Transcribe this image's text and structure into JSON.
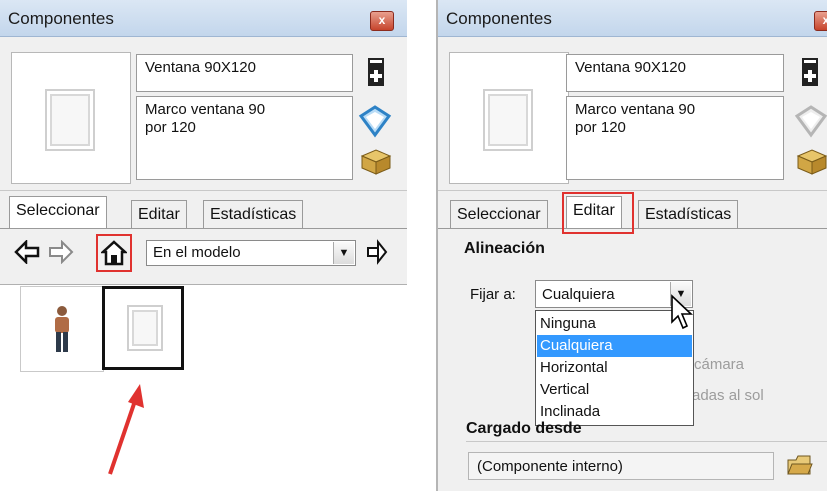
{
  "left_panel": {
    "title": "Componentes",
    "close_label": "x",
    "component_name": "Ventana 90X120",
    "component_description": "Marco ventana 90\npor 120",
    "tabs": [
      "Seleccionar",
      "Editar",
      "Estadísticas"
    ],
    "active_tab": "Seleccionar",
    "nav_icons": [
      "back-arrow-icon",
      "forward-arrow-icon",
      "home-icon"
    ],
    "location_select": "En el modelo",
    "details_icon": "details-arrow-icon",
    "component_items": [
      "person-icon",
      "window-icon"
    ]
  },
  "right_panel": {
    "title": "Componentes",
    "close_label": "x",
    "component_name": "Ventana 90X120",
    "component_description": "Marco ventana 90\npor 120",
    "tabs": [
      "Seleccionar",
      "Editar",
      "Estadísticas"
    ],
    "active_tab": "Editar",
    "section_alignment": "Alineación",
    "glue_label": "Fijar a:",
    "glue_value": "Cualquiera",
    "glue_options": [
      "Ninguna",
      "Cualquiera",
      "Horizontal",
      "Vertical",
      "Inclinada"
    ],
    "selected_option": "Cualquiera",
    "behind_text_1": "cámara",
    "behind_text_2": "adas al sol",
    "section_loaded_from": "Cargado desde",
    "loaded_from_value": "(Componente interno)"
  },
  "colors": {
    "highlight_red": "#e0322f",
    "selection_blue": "#3399ff"
  }
}
